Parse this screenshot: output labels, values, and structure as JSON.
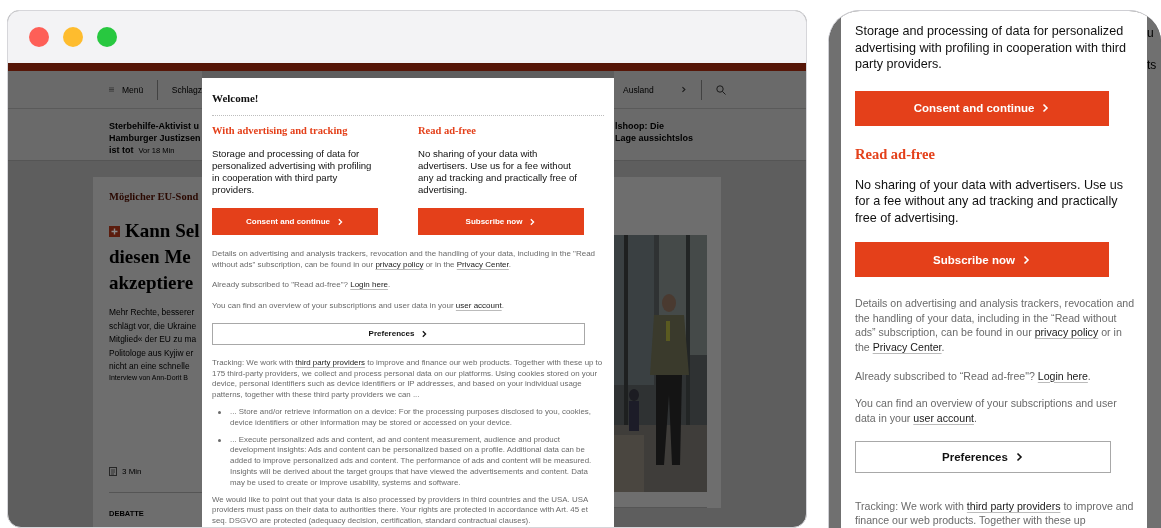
{
  "desktop_browser": {
    "background_page": {
      "nav_left": {
        "menu_label": "Menü",
        "item": "Schlagz"
      },
      "nav_right": {
        "item": "Ausland"
      },
      "ticker_left": {
        "lines": [
          "Sterbehilfe-Aktivist u",
          "Hamburger Justizsen",
          "ist tot"
        ],
        "time": "Vor 18 Min"
      },
      "ticker_right": {
        "lines": [
          "lshoop: Die",
          "Lage aussichtslos"
        ]
      },
      "article": {
        "kicker": "Möglicher EU-Sond",
        "headline_lines": [
          "Kann Sel",
          "diesen Me",
          "akzeptiere"
        ],
        "teaser_lines": [
          "Mehr Rechte, besserer",
          "schlägt vor, die Ukraine",
          "Mitglied« der EU zu ma",
          "Politologe aus Kyjiw er",
          "nicht an eine schnelle"
        ],
        "byline": "Interview von Ann-Dorit B",
        "read_time": "3 Min",
        "next_kicker": "DEBATTE"
      }
    },
    "consent_dialog": {
      "title": "Welcome!",
      "options": [
        {
          "heading": "With advertising and tracking",
          "text": "Storage and processing of data for personalized advertising with profiling in cooperation with third party providers.",
          "button": "Consent and continue"
        },
        {
          "heading": "Read ad-free",
          "text": "No sharing of your data with advertisers. Use us for a fee without any ad tracking and practically free of advertising.",
          "button": "Subscribe now"
        }
      ],
      "details": [
        {
          "text": "Details on advertising and analysis trackers, revocation and the handling of your data, including in the \"Read without ads\" subscription, can be found in our ",
          "link": false
        },
        {
          "text": "privacy policy",
          "link": true
        },
        {
          "text": " or in the ",
          "link": false
        },
        {
          "text": "Privacy Center",
          "link": true
        },
        {
          "text": ".",
          "link": false
        }
      ],
      "login": [
        {
          "text": "Already subscribed to \"Read ad-free\"? ",
          "link": false
        },
        {
          "text": "Login here",
          "link": true
        },
        {
          "text": ".",
          "link": false
        }
      ],
      "account": [
        {
          "text": "You can find an overview of your subscriptions and user data in your ",
          "link": false
        },
        {
          "text": "user account",
          "link": true
        },
        {
          "text": ".",
          "link": false
        }
      ],
      "preferences_button": "Preferences",
      "tracking": [
        {
          "text": "Tracking: We work with ",
          "link": false
        },
        {
          "text": "third party providers",
          "link": true
        },
        {
          "text": " to improve and finance our web products. Together with these up to 175 third-party providers, we collect and process personal data on our platforms. Using cookies stored on your device, personal identifiers such as device identifiers or IP addresses, and based on your individual usage patterns, together with these third party providers we can ...",
          "link": false
        }
      ],
      "bullets": [
        "... Store and/or retrieve information on a device: For the processing purposes disclosed to you, cookies, device identifiers or other information may be stored or accessed on your device.",
        "... Execute personalized ads and content, ad and content measurement, audience and product development insights: Ads and content can be personalized based on a profile. Additional data can be added to improve personalized ads and content. The performance of ads and content will be measured. Insights will be derived about the target groups that have viewed the advertisements and content. Data may be used to create or improve usability, systems and software."
      ],
      "third_countries": "We would like to point out that your data is also processed by providers in third countries and the USA. USA providers must pass on their data to authorities there. Your rights are protected in accordance with Art. 45 et seq. DSGVO are protected (adequacy decision, certification, standard contractual clauses)."
    }
  },
  "mobile": {
    "background_fragments": [
      "u",
      "ts"
    ],
    "intro_text": "Storage and processing of data for personalized advertising with profiling in cooperation with third party providers.",
    "consent_button": "Consent and continue",
    "ad_free": {
      "heading": "Read ad-free",
      "text": "No sharing of your data with advertisers. Use us for a fee without any ad tracking and practically free of advertising.",
      "button": "Subscribe now"
    },
    "details": [
      {
        "text": "Details on advertising and analysis trackers, revocation and the handling of your data, including in the “Read without ads” subscription, can be found in our ",
        "link": false
      },
      {
        "text": "privacy policy",
        "link": true
      },
      {
        "text": " or in the ",
        "link": false
      },
      {
        "text": "Privacy Center",
        "link": true
      },
      {
        "text": ".",
        "link": false
      }
    ],
    "login": [
      {
        "text": "Already subscribed to “Read ad-free\"? ",
        "link": false
      },
      {
        "text": "Login here",
        "link": true
      },
      {
        "text": ".",
        "link": false
      }
    ],
    "account": [
      {
        "text": "You can find an overview of your subscriptions and user data in your ",
        "link": false
      },
      {
        "text": "user account",
        "link": true
      },
      {
        "text": ".",
        "link": false
      }
    ],
    "preferences_button": "Preferences",
    "tracking": [
      {
        "text": "Tracking: We work with ",
        "link": false
      },
      {
        "text": "third party providers",
        "link": true
      },
      {
        "text": " to improve and finance our web products. Together with these up",
        "link": false
      }
    ]
  }
}
